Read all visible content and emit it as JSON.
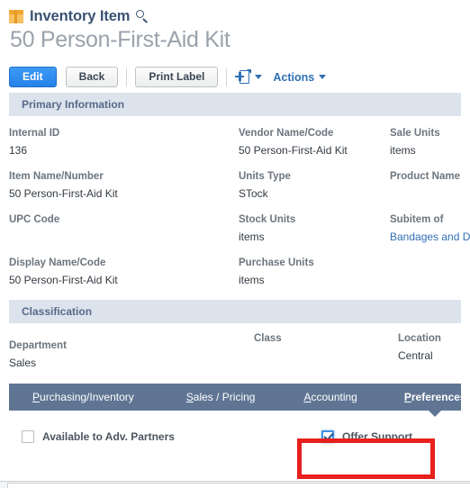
{
  "header": {
    "record_type": "Inventory Item",
    "record_type_icon": "package-box-icon",
    "search_icon": "search-icon",
    "document_title": "50 Person-First-Aid Kit"
  },
  "toolbar": {
    "edit_label": "Edit",
    "back_label": "Back",
    "print_label": "Print Label",
    "new_doc_icon": "new-document-icon",
    "actions_label": "Actions"
  },
  "primary_information": {
    "band_title": "Primary Information",
    "column1": [
      {
        "label": "Internal ID",
        "value": "136"
      },
      {
        "label": "Item Name/Number",
        "value": "50 Person-First-Aid Kit"
      },
      {
        "label": "UPC Code",
        "value": ""
      },
      {
        "label": "Display Name/Code",
        "value": "50 Person-First-Aid Kit"
      }
    ],
    "column2": [
      {
        "label": "Vendor Name/Code",
        "value": "50 Person-First-Aid Kit"
      },
      {
        "label": "Units Type",
        "value": "STock"
      },
      {
        "label": "Stock Units",
        "value": "items"
      },
      {
        "label": "Purchase Units",
        "value": "items"
      }
    ],
    "column3": [
      {
        "label": "Sale Units",
        "value": "items"
      },
      {
        "label": "Product Name",
        "value": ""
      },
      {
        "label": "Subitem of",
        "value": "Bandages and D",
        "is_link": true
      }
    ]
  },
  "classification": {
    "band_title": "Classification",
    "fields": [
      {
        "label": "Department",
        "value": "Sales"
      },
      {
        "label": "Class",
        "value": ""
      },
      {
        "label": "Location",
        "value": "Central"
      }
    ]
  },
  "tabs": [
    {
      "label": "Purchasing/Inventory",
      "accesskey": "P",
      "active": false
    },
    {
      "label": "Sales / Pricing",
      "accesskey": "S",
      "active": false
    },
    {
      "label": "Accounting",
      "accesskey": "A",
      "active": false
    },
    {
      "label": "Preferences",
      "accesskey": "P",
      "active": true
    }
  ],
  "preferences": {
    "checkboxes": [
      {
        "label": "Available to Adv. Partners",
        "checked": false
      },
      {
        "label": "Offer Support",
        "checked": true
      }
    ]
  },
  "annotation": {
    "target": "Offer Support",
    "color": "#e8201e"
  },
  "colors": {
    "accent_blue": "#2f6fb5",
    "primary_button": "#2681e8",
    "band_background": "#dde3ec",
    "band_text": "#56698a",
    "tabbar_background": "#5f7593",
    "annotation_red": "#e8201e",
    "title_grey": "#9aa2ab"
  }
}
